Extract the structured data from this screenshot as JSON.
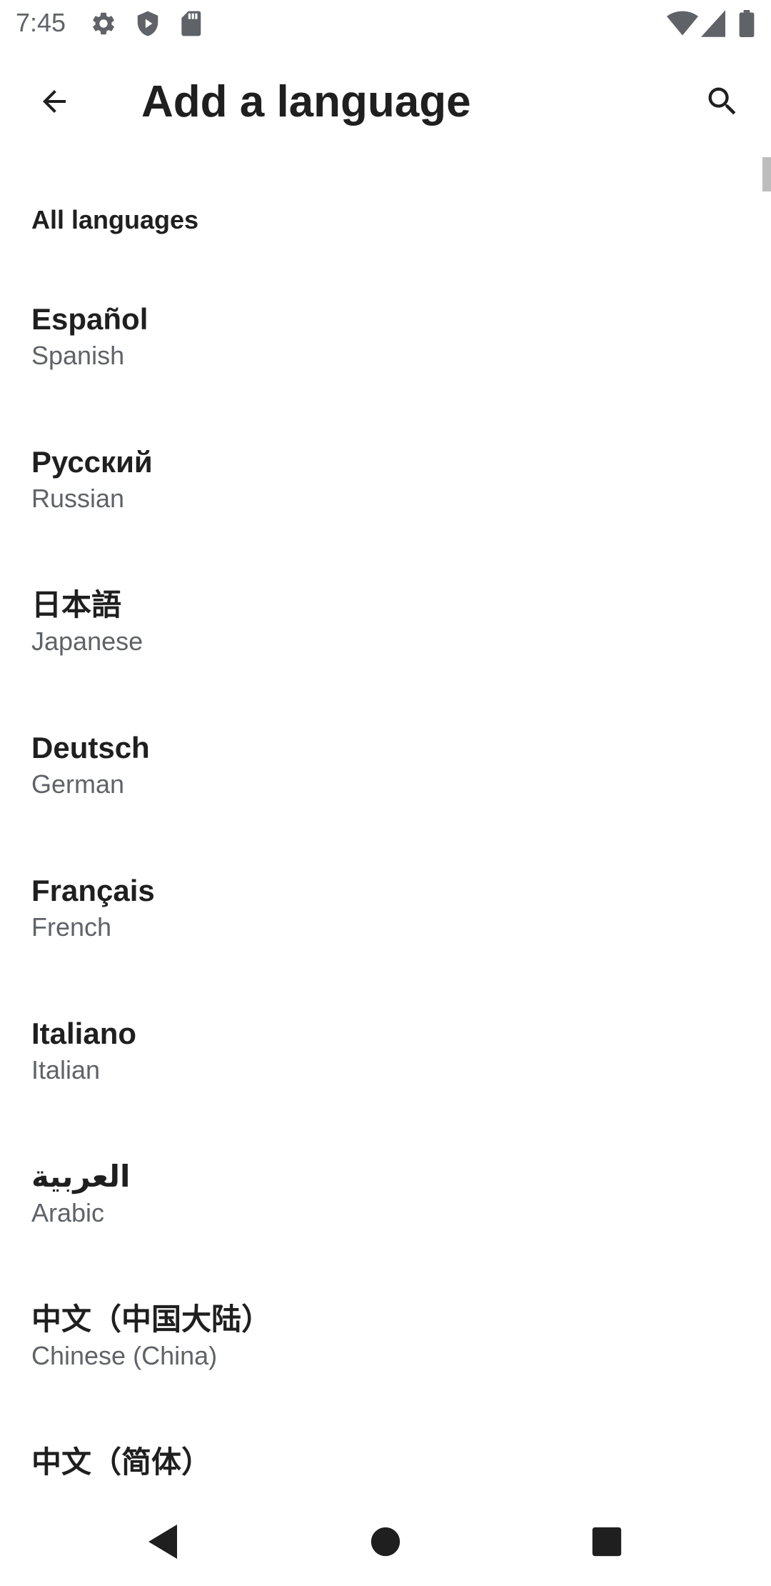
{
  "status_bar": {
    "time": "7:45",
    "left_icons": [
      "gear-icon",
      "shield-play-icon",
      "sd-card-icon"
    ],
    "right_icons": [
      "wifi-icon",
      "cell-signal-icon",
      "battery-icon"
    ]
  },
  "app_bar": {
    "title": "Add a language",
    "back_icon": "arrow-back-icon",
    "search_icon": "search-icon"
  },
  "section": {
    "header": "All languages"
  },
  "languages": [
    {
      "native": "Español",
      "english": "Spanish"
    },
    {
      "native": "Русский",
      "english": "Russian"
    },
    {
      "native": "日本語",
      "english": "Japanese"
    },
    {
      "native": "Deutsch",
      "english": "German"
    },
    {
      "native": "Français",
      "english": "French"
    },
    {
      "native": "Italiano",
      "english": "Italian"
    },
    {
      "native": "العربية",
      "english": "Arabic"
    },
    {
      "native": "中文（中国大陆）",
      "english": "Chinese (China)"
    },
    {
      "native": "中文（简体）",
      "english": ""
    }
  ],
  "nav_bar": {
    "back": "nav-back-icon",
    "home": "nav-home-icon",
    "recents": "nav-recents-icon"
  },
  "colors": {
    "primary_text": "#1f1f1f",
    "secondary_text": "#5f6368",
    "icon": "#5f6368",
    "background": "#ffffff"
  }
}
